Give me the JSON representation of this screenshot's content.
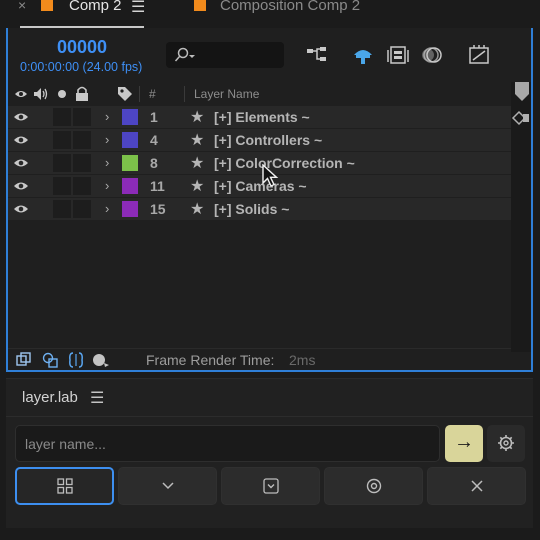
{
  "tabs": {
    "close_glyph": "×",
    "active_label": "Comp 2",
    "menu_glyph": "☰",
    "inactive_label": "Composition Comp 2",
    "swatch_color": "#f28b1c"
  },
  "timeline": {
    "timecode": "00000",
    "fps_text": "0:00:00:00 (24.00 fps)",
    "columns": {
      "hash": "#",
      "layer_name": "Layer Name"
    },
    "layers": [
      {
        "num": "1",
        "label": "[+] Elements ~",
        "color": "#4d45c4"
      },
      {
        "num": "4",
        "label": "[+] Controllers ~",
        "color": "#4d45c4"
      },
      {
        "num": "8",
        "label": "[+] ColorCorrection ~",
        "color": "#7cc14a"
      },
      {
        "num": "11",
        "label": "[+] Cameras ~",
        "color": "#8c2bb8"
      },
      {
        "num": "15",
        "label": "[+] Solids ~",
        "color": "#8c2bb8"
      }
    ],
    "expand_glyph": "›",
    "star_glyph": "★",
    "frame_render_label": "Frame Render Time:",
    "frame_render_value": "2ms"
  },
  "layerlab": {
    "title": "layer.lab",
    "menu_glyph": "☰",
    "input_placeholder": "layer name...",
    "go_glyph": "→",
    "accent_color": "#d9d59a",
    "selection_color": "#3d8ff0"
  }
}
